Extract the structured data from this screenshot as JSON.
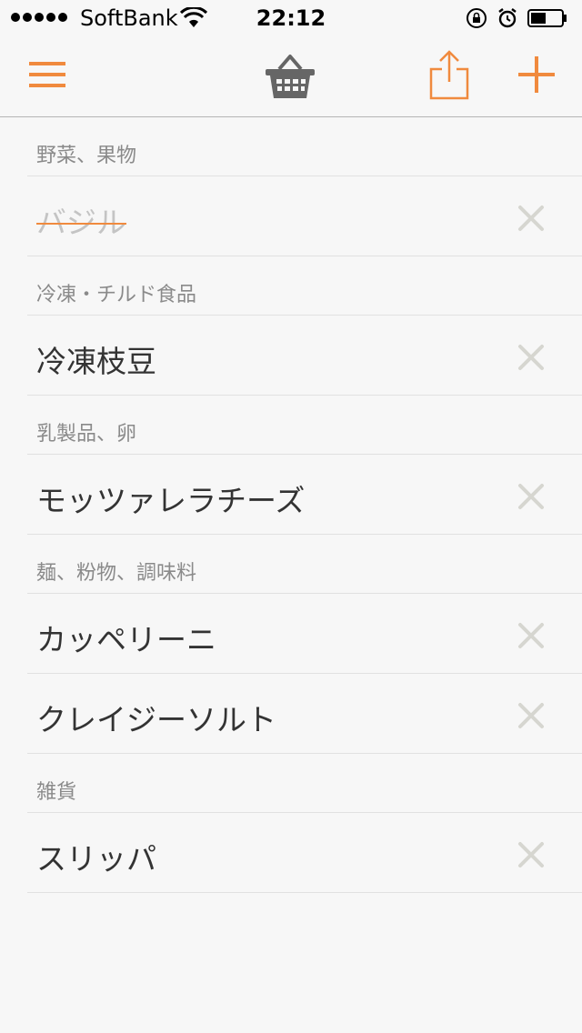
{
  "status_bar": {
    "carrier": "SoftBank",
    "time": "22:12"
  },
  "nav": {
    "menu_icon": "hamburger-menu-icon",
    "title_icon": "basket-icon",
    "share_icon": "share-icon",
    "add_icon": "plus-icon",
    "accent_color": "#f08a3e"
  },
  "sections": [
    {
      "title": "野菜、果物",
      "items": [
        {
          "name": "バジル",
          "checked": true
        }
      ]
    },
    {
      "title": "冷凍・チルド食品",
      "items": [
        {
          "name": "冷凍枝豆",
          "checked": false
        }
      ]
    },
    {
      "title": "乳製品、卵",
      "items": [
        {
          "name": "モッツァレラチーズ",
          "checked": false
        }
      ]
    },
    {
      "title": "麺、粉物、調味料",
      "items": [
        {
          "name": "カッペリーニ",
          "checked": false
        },
        {
          "name": "クレイジーソルト",
          "checked": false
        }
      ]
    },
    {
      "title": "雑貨",
      "items": [
        {
          "name": "スリッパ",
          "checked": false
        }
      ]
    }
  ]
}
